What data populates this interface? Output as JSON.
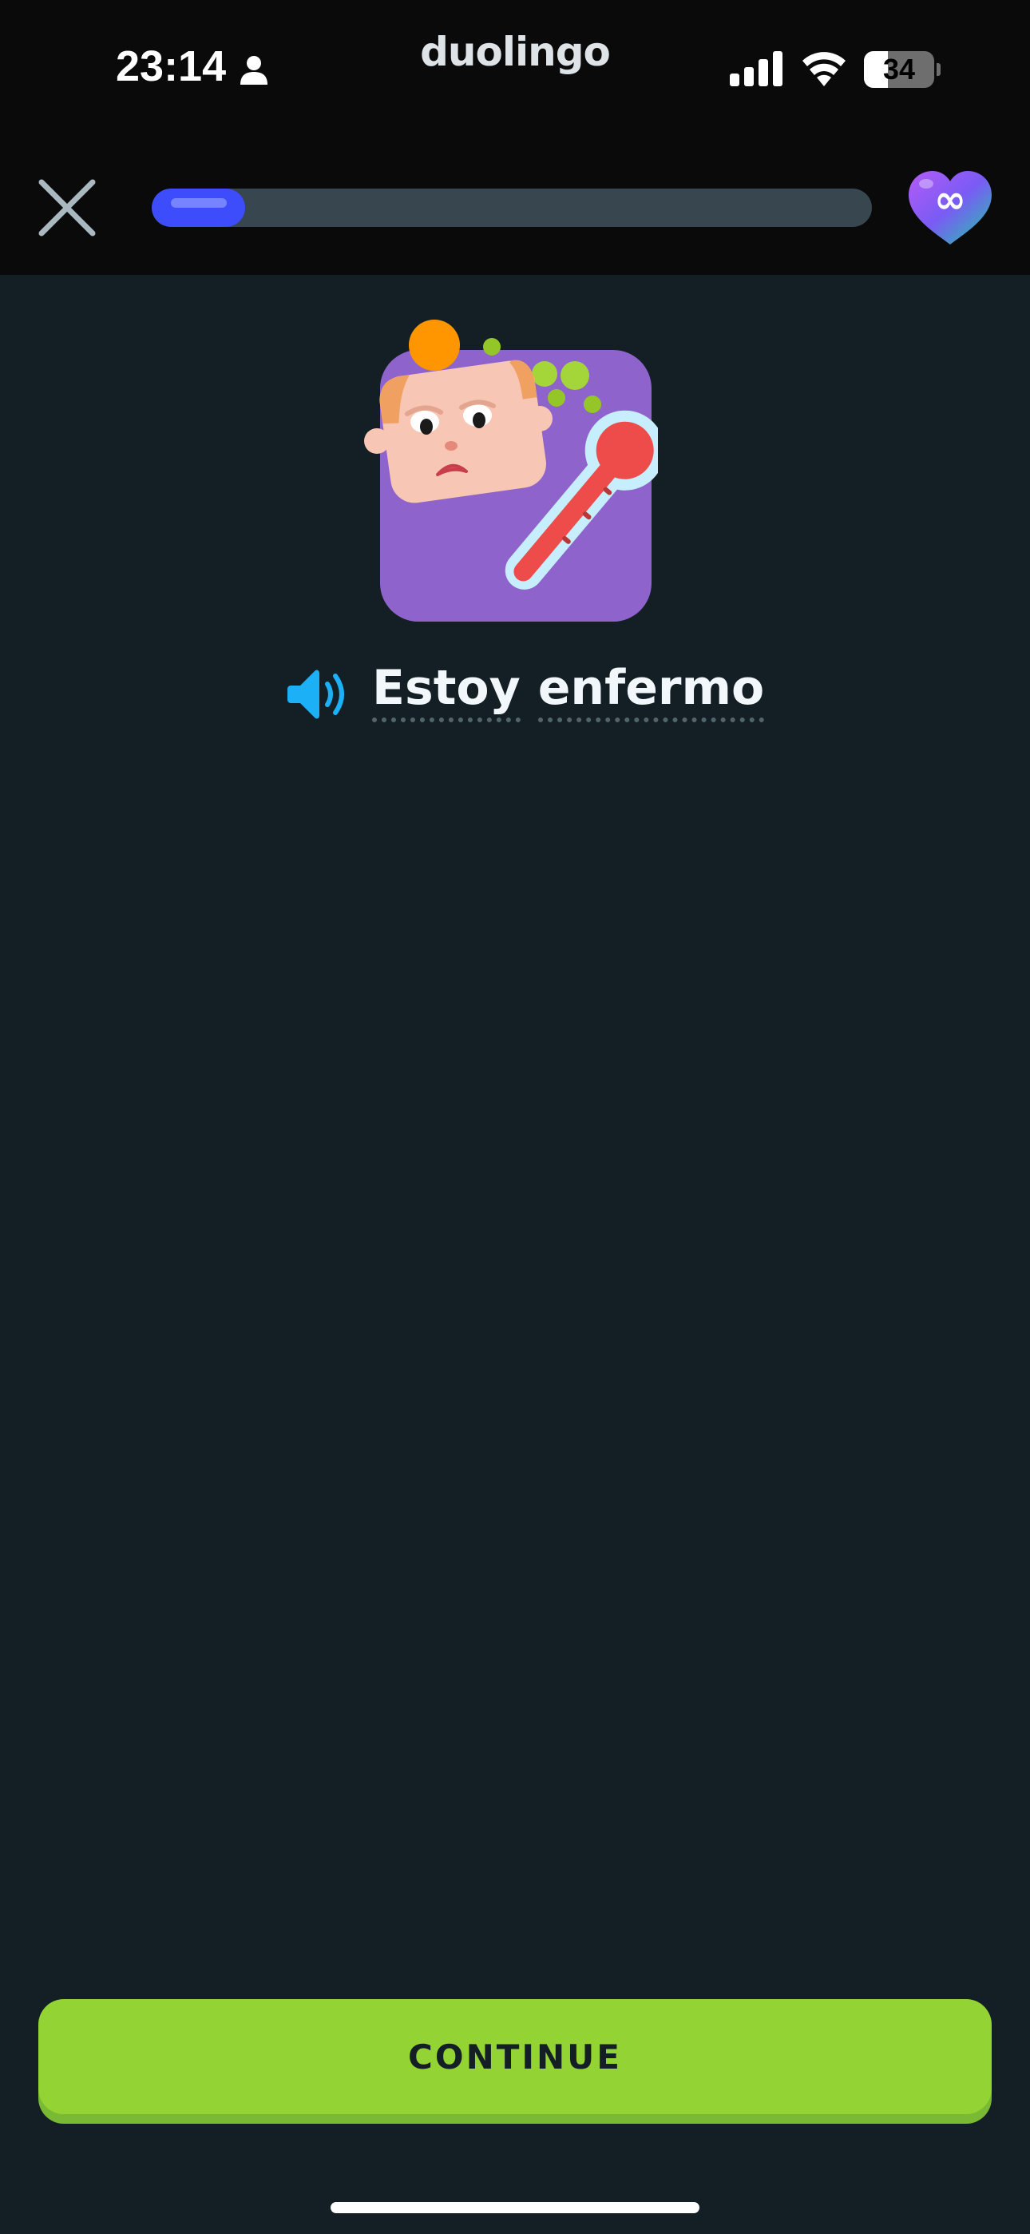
{
  "status_bar": {
    "time": "23:14",
    "battery_level": 34,
    "battery_text": "34",
    "icons": [
      "person-icon",
      "cellular-signal-icon",
      "wifi-icon",
      "battery-icon"
    ]
  },
  "app": {
    "name": "duolingo"
  },
  "lesson": {
    "progress_fraction": 0.13,
    "hearts": "∞",
    "icons": [
      "close-icon",
      "infinity-heart-icon",
      "speaker-icon"
    ]
  },
  "prompt": {
    "phrase_words": [
      "Estoy",
      "enfermo"
    ]
  },
  "footer": {
    "continue_label": "CONTINUE"
  },
  "colors": {
    "background": "#131f24",
    "header": "#0a0a0a",
    "progress_fill": "#3d4dfc",
    "progress_track": "#37464f",
    "continue_button": "#93d333",
    "speaker": "#1cb0f6",
    "illustration_bg": "#8f63cc"
  }
}
